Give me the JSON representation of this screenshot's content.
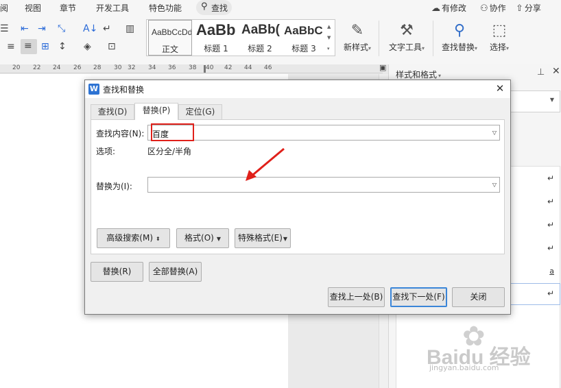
{
  "menubar": {
    "items": [
      "阅",
      "视图",
      "章节",
      "开发工具",
      "特色功能"
    ],
    "search_label": "查找",
    "right": {
      "revise": "有修改",
      "collab": "协作",
      "share": "分享"
    }
  },
  "ribbon": {
    "styles": [
      {
        "preview": "AaBbCcDd",
        "label": "正文"
      },
      {
        "preview": "AaBb",
        "label": "标题 1"
      },
      {
        "preview": "AaBb(",
        "label": "标题 2"
      },
      {
        "preview": "AaBbC",
        "label": "标题 3"
      }
    ],
    "new_style": "新样式",
    "text_tools": "文字工具",
    "find_replace": "查找替换",
    "select": "选择"
  },
  "ruler": {
    "ticks": [
      "20",
      "22",
      "24",
      "26",
      "28",
      "30",
      "32",
      "34",
      "36",
      "38",
      "40",
      "42",
      "44",
      "46"
    ]
  },
  "styles_panel": {
    "title": "样式和格式"
  },
  "watermark": {
    "brand": "Baidu 经验",
    "domain": "jingyan.baidu.com"
  },
  "dialog": {
    "title": "查找和替换",
    "tabs": [
      "查找(D)",
      "替换(P)",
      "定位(G)"
    ],
    "active_tab": "替换(P)",
    "find_label": "查找内容(N):",
    "find_value": "百度",
    "options_label": "选项:",
    "options_value": "区分全/半角",
    "replace_label": "替换为(I):",
    "replace_value": "",
    "advanced_search": "高级搜索(M)",
    "format": "格式(O)",
    "special_format": "特殊格式(E)",
    "replace": "替换(R)",
    "replace_all": "全部替换(A)",
    "find_prev": "查找上一处(B)",
    "find_next": "查找下一处(F)",
    "close": "关闭"
  }
}
